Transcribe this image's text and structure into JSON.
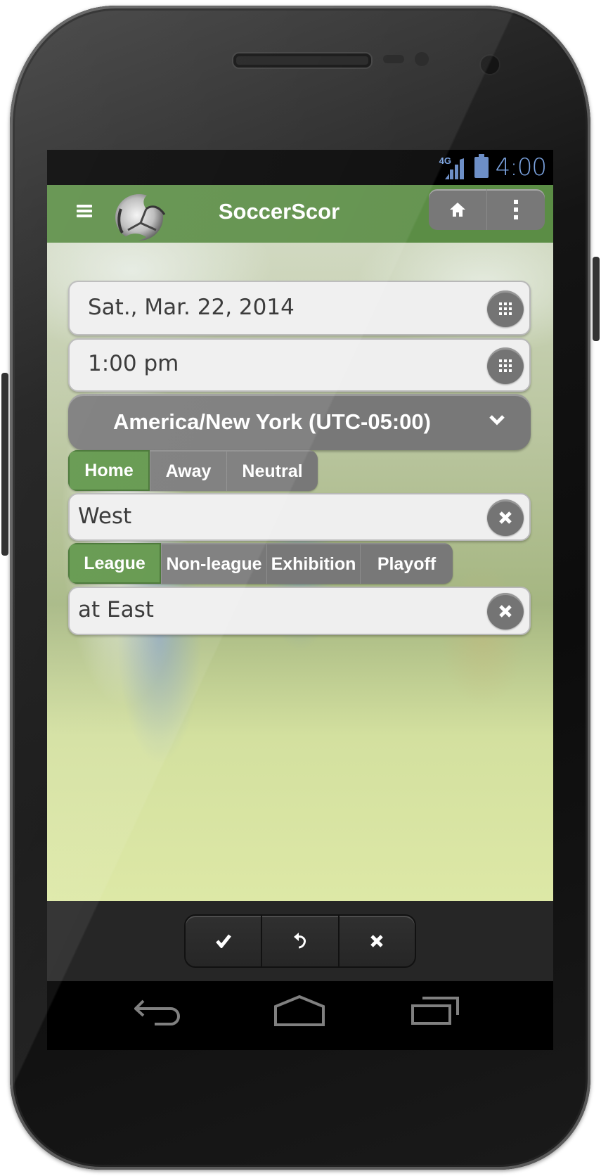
{
  "status_bar": {
    "network": "4G",
    "time": "4:00",
    "colors": {
      "icons": "#7ba3e0"
    }
  },
  "header": {
    "title": "SoccerScor",
    "menu_icon": "hamburger-icon",
    "logo_icon": "soccer-ball-logo",
    "actions": [
      {
        "name": "home",
        "icon": "home-icon"
      },
      {
        "name": "more",
        "icon": "more-vertical-icon"
      }
    ],
    "colors": {
      "background": "#5b8d45"
    }
  },
  "form": {
    "date": {
      "value": "Sat., Mar. 22, 2014",
      "button_icon": "grid-icon"
    },
    "time": {
      "value": "1:00 pm",
      "button_icon": "grid-icon"
    },
    "timezone": {
      "label": "America/New York (UTC-05:00)",
      "icon": "chevron-down-icon"
    },
    "venue": {
      "options": [
        "Home",
        "Away",
        "Neutral"
      ],
      "selected": "Home"
    },
    "team": {
      "value": "West",
      "clear_icon": "clear-icon"
    },
    "game_type": {
      "options": [
        "League",
        "Non-league",
        "Exhibition",
        "Playoff"
      ],
      "selected": "League"
    },
    "opponent": {
      "value": "at East",
      "clear_icon": "clear-icon"
    },
    "colors": {
      "active_segment": "#5d9446",
      "inactive_segment": "#787878"
    }
  },
  "footer": {
    "buttons": [
      {
        "name": "save",
        "icon": "check-icon"
      },
      {
        "name": "undo",
        "icon": "undo-icon"
      },
      {
        "name": "cancel",
        "icon": "close-icon"
      }
    ]
  },
  "nav_bar": {
    "buttons": [
      {
        "name": "back",
        "icon": "back-icon"
      },
      {
        "name": "home",
        "icon": "home-outline-icon"
      },
      {
        "name": "recents",
        "icon": "recents-icon"
      }
    ]
  }
}
